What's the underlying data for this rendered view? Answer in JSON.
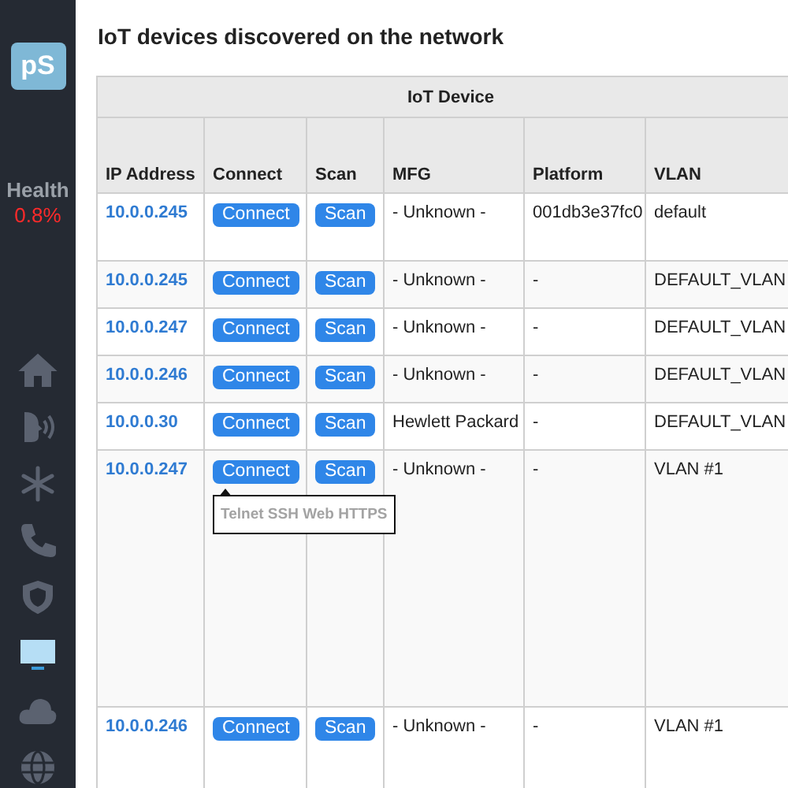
{
  "sidebar": {
    "logo": "pS",
    "health_label": "Health",
    "health_value": "0.8%",
    "items": [
      {
        "selected": false
      },
      {
        "selected": false
      },
      {
        "selected": false
      },
      {
        "selected": false
      },
      {
        "selected": false
      },
      {
        "selected": true
      },
      {
        "selected": false
      },
      {
        "selected": false
      }
    ]
  },
  "title": "IoT devices discovered on the network",
  "table": {
    "group_header": "IoT Device",
    "columns": [
      "IP Address",
      "Connect",
      "Scan",
      "MFG",
      "Platform",
      "VLAN"
    ],
    "rows": [
      {
        "ip": "10.0.0.245",
        "connect": "Connect",
        "scan": "Scan",
        "mfg": "- Unknown -",
        "platform": "001db3e37fc0",
        "vlan": "default"
      },
      {
        "ip": "10.0.0.245",
        "connect": "Connect",
        "scan": "Scan",
        "mfg": "- Unknown -",
        "platform": "-",
        "vlan": "DEFAULT_VLAN"
      },
      {
        "ip": "10.0.0.247",
        "connect": "Connect",
        "scan": "Scan",
        "mfg": "- Unknown -",
        "platform": "-",
        "vlan": "DEFAULT_VLAN"
      },
      {
        "ip": "10.0.0.246",
        "connect": "Connect",
        "scan": "Scan",
        "mfg": "- Unknown -",
        "platform": "-",
        "vlan": "DEFAULT_VLAN"
      },
      {
        "ip": "10.0.0.30",
        "connect": "Connect",
        "scan": "Scan",
        "mfg": "Hewlett Packard",
        "platform": "-",
        "vlan": "DEFAULT_VLAN"
      },
      {
        "ip": "10.0.0.247",
        "connect": "Connect",
        "scan": "Scan",
        "mfg": "- Unknown -",
        "platform": "-",
        "vlan": "VLAN #1",
        "tooltip": "Telnet SSH Web HTTPS"
      },
      {
        "ip": "10.0.0.246",
        "connect": "Connect",
        "scan": "Scan",
        "mfg": "- Unknown -",
        "platform": "-",
        "vlan": "VLAN #1"
      }
    ]
  }
}
